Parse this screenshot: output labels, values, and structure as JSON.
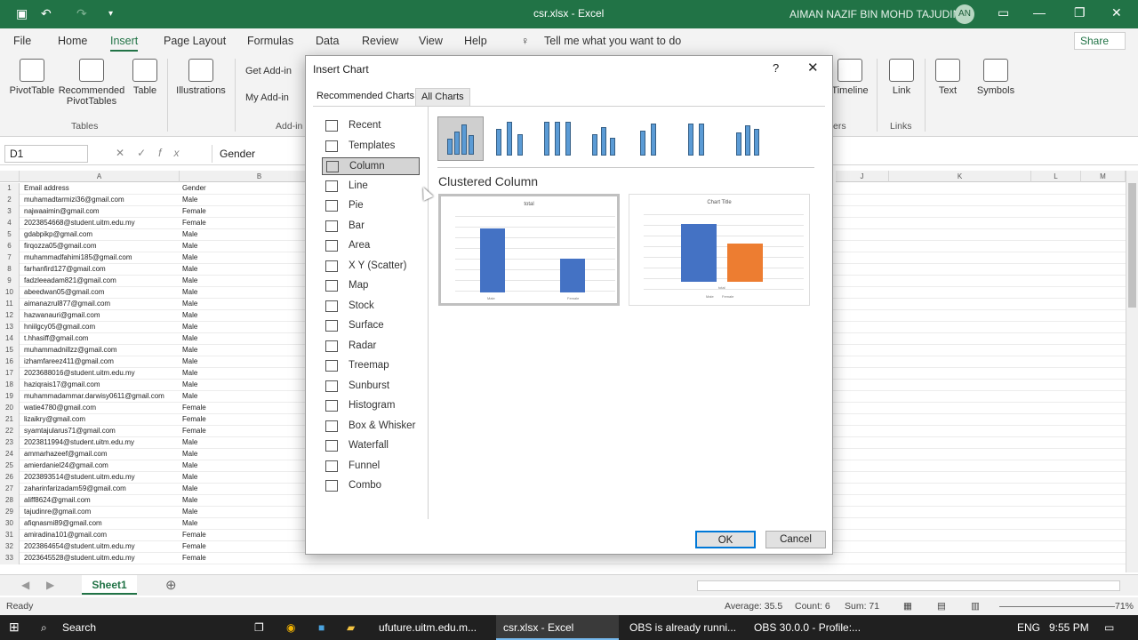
{
  "window": {
    "title": "csr.xlsx - Excel",
    "user": "AIMAN NAZIF BIN MOHD TAJUDIN",
    "user_initials": "AN"
  },
  "menu": {
    "items": [
      "File",
      "Home",
      "Insert",
      "Page Layout",
      "Formulas",
      "Data",
      "Review",
      "View",
      "Help"
    ],
    "active": "Insert",
    "tell_me": "Tell me what you want to do",
    "share": "Share"
  },
  "ribbon": {
    "pivottable": "PivotTable",
    "recommended_pivot_line1": "Recommended",
    "recommended_pivot_line2": "PivotTables",
    "table": "Table",
    "tables_group": "Tables",
    "illustrations": "Illustrations",
    "get_addins": "Get Add-in",
    "my_addins": "My Add-in",
    "addins_group": "Add-in",
    "timeline": "Timeline",
    "filters_group": "ers",
    "link": "Link",
    "links_group": "Links",
    "text": "Text",
    "symbols": "Symbols"
  },
  "formula_bar": {
    "name_box": "D1",
    "fx": "fx",
    "value": "Gender"
  },
  "sheet": {
    "columns": [
      "A",
      "B",
      "J",
      "K",
      "L",
      "M"
    ],
    "rows": [
      [
        "1",
        "Email address",
        "Gender"
      ],
      [
        "2",
        "muhamadtarmizi36@gmail.com",
        "Male"
      ],
      [
        "3",
        "najwaaimin@gmail.com",
        "Female"
      ],
      [
        "4",
        "2023854668@student.uitm.edu.my",
        "Female"
      ],
      [
        "5",
        "gdabpikp@gmail.com",
        "Male"
      ],
      [
        "6",
        "firqozza05@gmail.com",
        "Male"
      ],
      [
        "7",
        "muhammadfahimi185@gmail.com",
        "Male"
      ],
      [
        "8",
        "farhanfird127@gmail.com",
        "Male"
      ],
      [
        "9",
        "fadzleeadam821@gmail.com",
        "Male"
      ],
      [
        "10",
        "abeedwan05@gmail.com",
        "Male"
      ],
      [
        "11",
        "aimanazrul877@gmail.com",
        "Male"
      ],
      [
        "12",
        "hazwanauri@gmail.com",
        "Male"
      ],
      [
        "13",
        "hniilgcy05@gmail.com",
        "Male"
      ],
      [
        "14",
        "t.hhasiff@gmail.com",
        "Male"
      ],
      [
        "15",
        "muhammadnillzz@gmail.com",
        "Male"
      ],
      [
        "16",
        "izhamfareez411@gmail.com",
        "Male"
      ],
      [
        "17",
        "2023688016@student.uitm.edu.my",
        "Male"
      ],
      [
        "18",
        "haziqrais17@gmail.com",
        "Male"
      ],
      [
        "19",
        "muhammadammar.darwisy0611@gmail.com",
        "Male"
      ],
      [
        "20",
        "watie4780@gmail.com",
        "Female"
      ],
      [
        "21",
        "lizaikry@gmail.com",
        "Female"
      ],
      [
        "22",
        "syamtajularus71@gmail.com",
        "Female"
      ],
      [
        "23",
        "2023811994@student.uitm.edu.my",
        "Male"
      ],
      [
        "24",
        "ammarhazeef@gmail.com",
        "Male"
      ],
      [
        "25",
        "amierdaniel24@gmail.com",
        "Male"
      ],
      [
        "26",
        "2023893514@student.uitm.edu.my",
        "Male"
      ],
      [
        "27",
        "zaharinfarizadam59@gmail.com",
        "Male"
      ],
      [
        "28",
        "aliff8624@gmail.com",
        "Male"
      ],
      [
        "29",
        "tajudinre@gmail.com",
        "Male"
      ],
      [
        "30",
        "afiqnasmi89@gmail.com",
        "Male"
      ],
      [
        "31",
        "amiradina101@gmail.com",
        "Female"
      ],
      [
        "32",
        "2023864654@student.uitm.edu.my",
        "Female"
      ],
      [
        "33",
        "2023645528@student.uitm.edu.my",
        "Female"
      ]
    ],
    "sheet_tab": "Sheet1"
  },
  "status": {
    "ready": "Ready",
    "average": "Average: 35.5",
    "count": "Count: 6",
    "sum": "Sum: 71",
    "zoom": "71%"
  },
  "dialog": {
    "title": "Insert Chart",
    "help": "?",
    "close": "✕",
    "tabs": [
      "Recommended Charts",
      "All Charts"
    ],
    "active_tab": "All Charts",
    "categories": [
      "Recent",
      "Templates",
      "Column",
      "Line",
      "Pie",
      "Bar",
      "Area",
      "X Y (Scatter)",
      "Map",
      "Stock",
      "Surface",
      "Radar",
      "Treemap",
      "Sunburst",
      "Histogram",
      "Box & Whisker",
      "Waterfall",
      "Funnel",
      "Combo"
    ],
    "selected_category": "Column",
    "variant_name": "Clustered Column",
    "preview1": {
      "title": "total",
      "categories": [
        "Male",
        "Female"
      ],
      "values": [
        0.75,
        0.4
      ]
    },
    "preview2": {
      "title": "Chart Title",
      "category": "total",
      "legend": [
        "Male",
        "Female"
      ],
      "values": [
        0.68,
        0.45
      ]
    },
    "ok": "OK",
    "cancel": "Cancel"
  },
  "taskbar": {
    "search": "Search",
    "tasks": [
      "ufuture.uitm.edu.m...",
      "csr.xlsx - Excel",
      "OBS is already runni...",
      "OBS 30.0.0 - Profile:..."
    ],
    "lang": "ENG",
    "time": "9:55 PM"
  }
}
